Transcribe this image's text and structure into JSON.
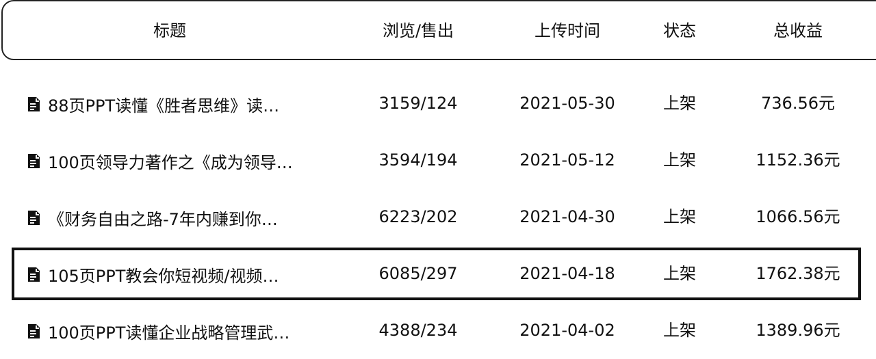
{
  "headers": {
    "title": "标题",
    "views_sales": "浏览/售出",
    "upload_time": "上传时间",
    "status": "状态",
    "total_revenue": "总收益"
  },
  "rows": [
    {
      "title": "88页PPT读懂《胜者思维》读…",
      "views_sales": "3159/124",
      "upload_time": "2021-05-30",
      "status": "上架",
      "total_revenue": "736.56元"
    },
    {
      "title": "100页领导力著作之《成为领导…",
      "views_sales": "3594/194",
      "upload_time": "2021-05-12",
      "status": "上架",
      "total_revenue": "1152.36元"
    },
    {
      "title": "《财务自由之路-7年内赚到你…",
      "views_sales": "6223/202",
      "upload_time": "2021-04-30",
      "status": "上架",
      "total_revenue": "1066.56元"
    },
    {
      "title": "105页PPT教会你短视频/视频…",
      "views_sales": "6085/297",
      "upload_time": "2021-04-18",
      "status": "上架",
      "total_revenue": "1762.38元"
    },
    {
      "title": "100页PPT读懂企业战略管理武…",
      "views_sales": "4388/234",
      "upload_time": "2021-04-02",
      "status": "上架",
      "total_revenue": "1389.96元"
    }
  ],
  "icons": {
    "document": "document-icon"
  }
}
